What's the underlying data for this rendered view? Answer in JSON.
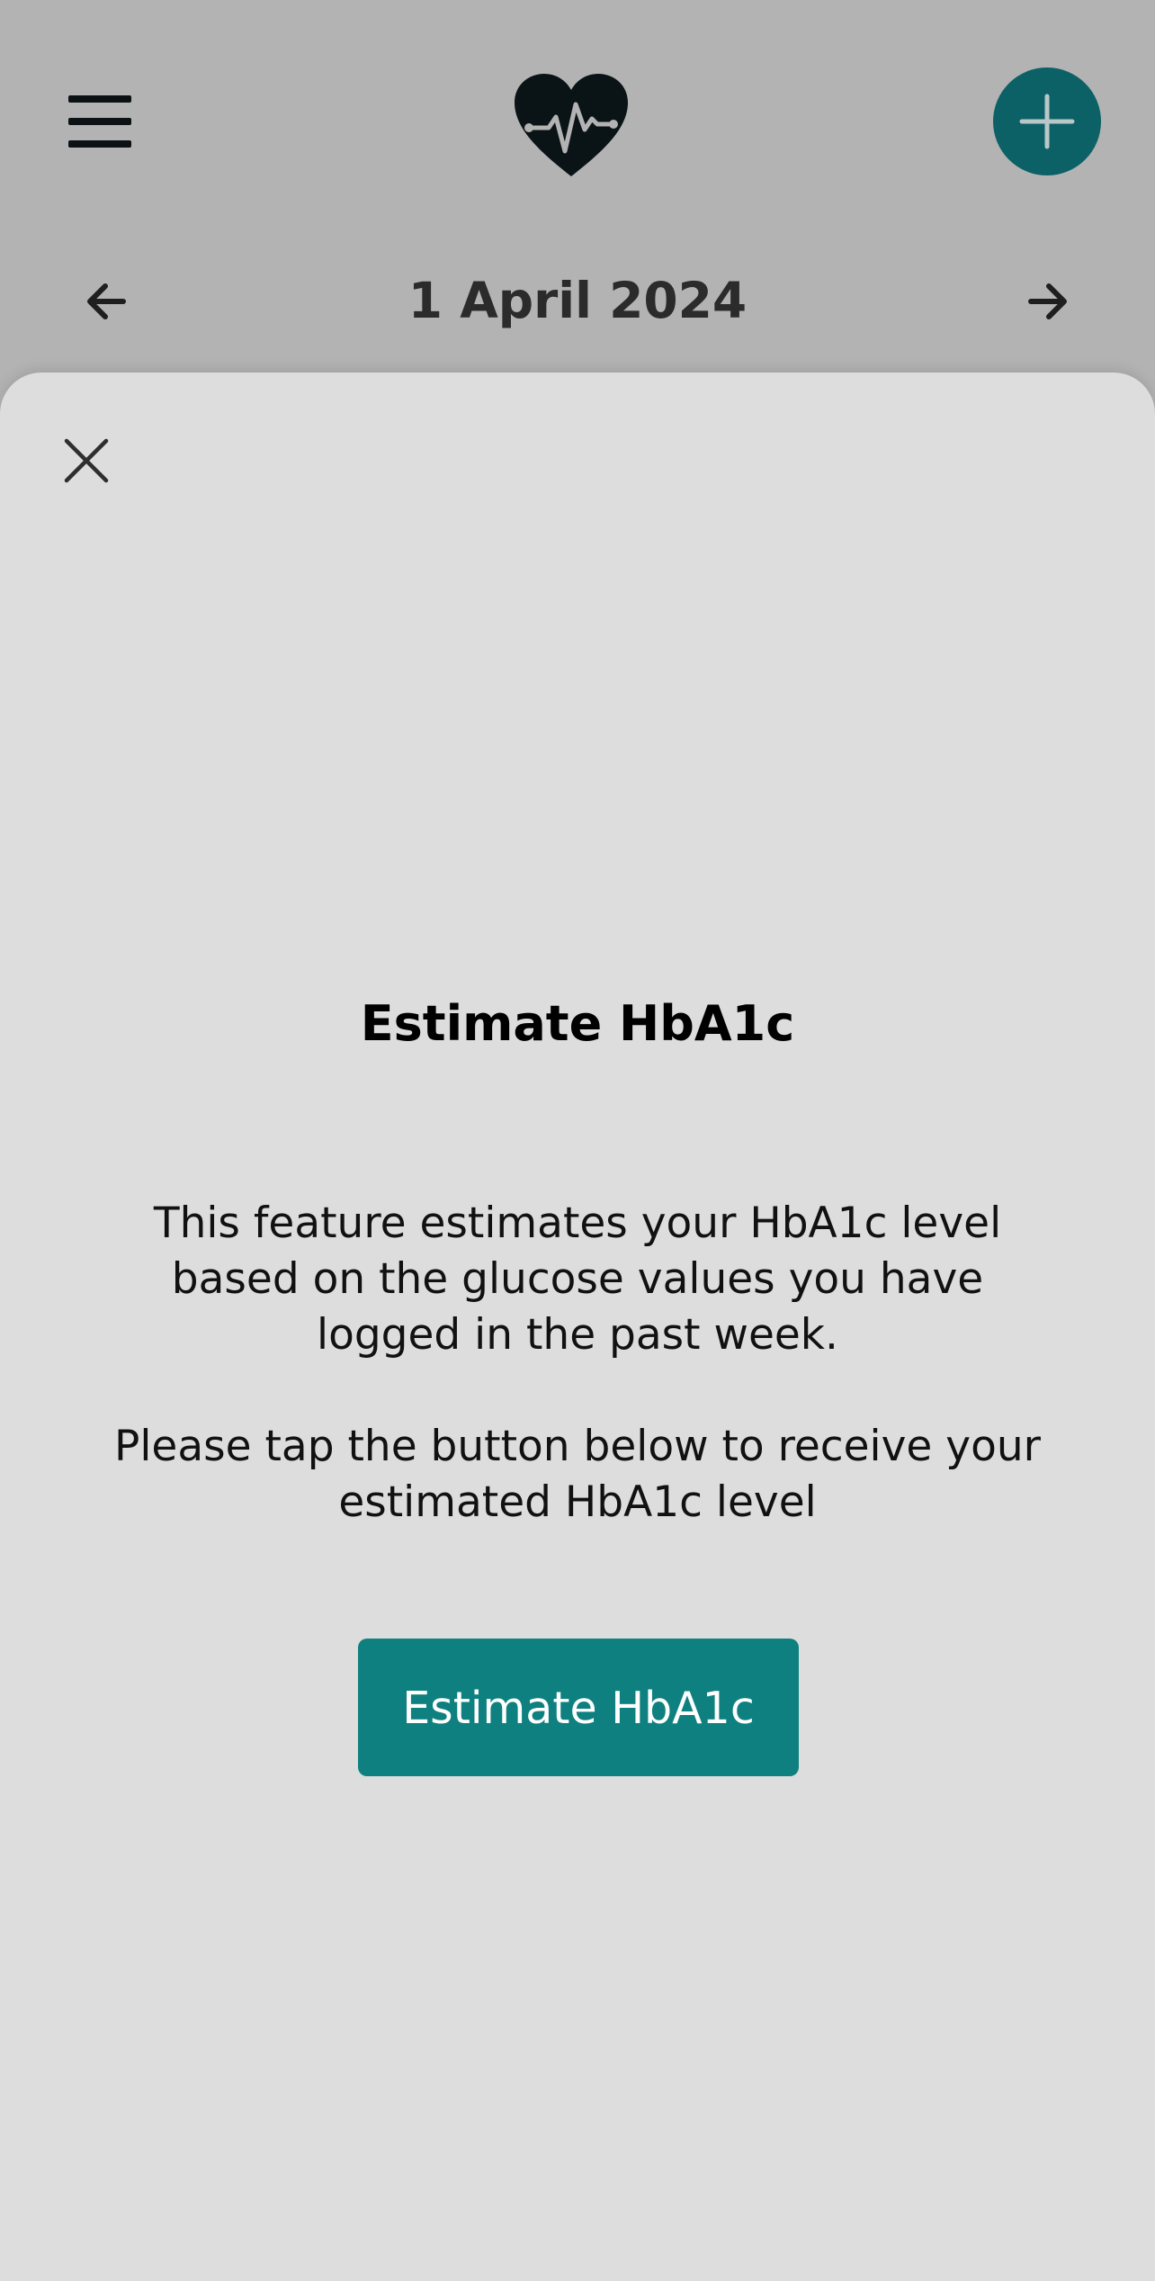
{
  "header": {
    "menu_icon": "hamburger-menu-icon",
    "logo_icon": "heart-pulse-icon",
    "add_icon": "plus-icon",
    "accent_color": "#0c6166"
  },
  "date_nav": {
    "prev_icon": "arrow-left-icon",
    "date": "1 April 2024",
    "next_icon": "arrow-right-icon"
  },
  "sheet": {
    "close_icon": "close-icon",
    "title": "Estimate HbA1c",
    "description": "This feature estimates your HbA1c level based on the glucose values you have logged in the past week.",
    "instruction": "Please tap the button below to receive your estimated HbA1c level",
    "button_label": "Estimate HbA1c",
    "button_color": "#0e8080"
  }
}
